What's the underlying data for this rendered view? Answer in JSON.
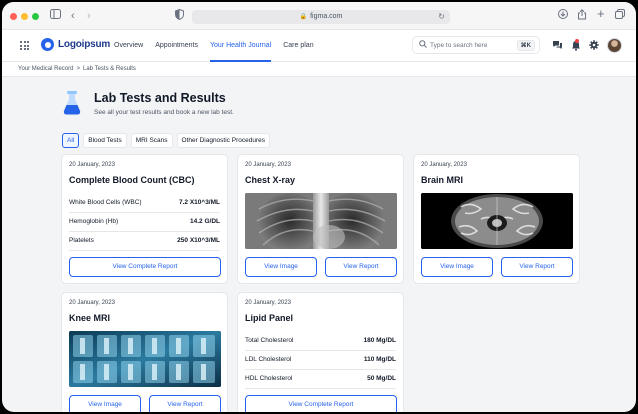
{
  "browser": {
    "url": "figma.com"
  },
  "nav": {
    "logo": "Logoipsum",
    "links": [
      {
        "label": "Overview",
        "active": false
      },
      {
        "label": "Appointments",
        "active": false
      },
      {
        "label": "Your Health Journal",
        "active": true
      },
      {
        "label": "Care plan",
        "active": false
      }
    ],
    "search_placeholder": "Type to search here",
    "search_shortcut": "⌘K"
  },
  "breadcrumb": {
    "items": [
      "Your Medical Record",
      "Lab Tests & Results"
    ],
    "separator": ">"
  },
  "page": {
    "title": "Lab Tests and Results",
    "subtitle": "See all your test results and book a new lab test."
  },
  "filters": [
    {
      "label": "All",
      "active": true
    },
    {
      "label": "Blood Tests",
      "active": false
    },
    {
      "label": "MRI Scans",
      "active": false
    },
    {
      "label": "Other Diagnostic Procedures",
      "active": false
    }
  ],
  "cards": {
    "cbc": {
      "date": "20 January, 2023",
      "title": "Complete Blood Count (CBC)",
      "rows": [
        {
          "label": "White Blood Cells (WBC)",
          "value": "7.2 X10^3/ML"
        },
        {
          "label": "Hemoglobin (Hb)",
          "value": "14.2 G/DL"
        },
        {
          "label": "Platelets",
          "value": "250 X10^3/ML"
        }
      ],
      "button": "View Complete Report"
    },
    "xray": {
      "date": "20 January, 2023",
      "title": "Chest X-ray",
      "btn_image": "View Image",
      "btn_report": "View Report"
    },
    "brain": {
      "date": "20 January, 2023",
      "title": "Brain MRI",
      "btn_image": "View Image",
      "btn_report": "View Report"
    },
    "knee": {
      "date": "20 January, 2023",
      "title": "Knee MRI",
      "btn_image": "View Image",
      "btn_report": "View Report"
    },
    "lipid": {
      "date": "20 January, 2023",
      "title": "Lipid Panel",
      "rows": [
        {
          "label": "Total Cholesterol",
          "value": "180 Mg/DL"
        },
        {
          "label": "LDL Cholesterol",
          "value": "110 Mg/DL"
        },
        {
          "label": "HDL Cholesterol",
          "value": "50 Mg/DL"
        }
      ],
      "button": "View Complete Report"
    }
  },
  "colors": {
    "accent": "#2563eb",
    "background": "#f3f4f6",
    "card": "#ffffff",
    "border": "#e5e7eb"
  }
}
